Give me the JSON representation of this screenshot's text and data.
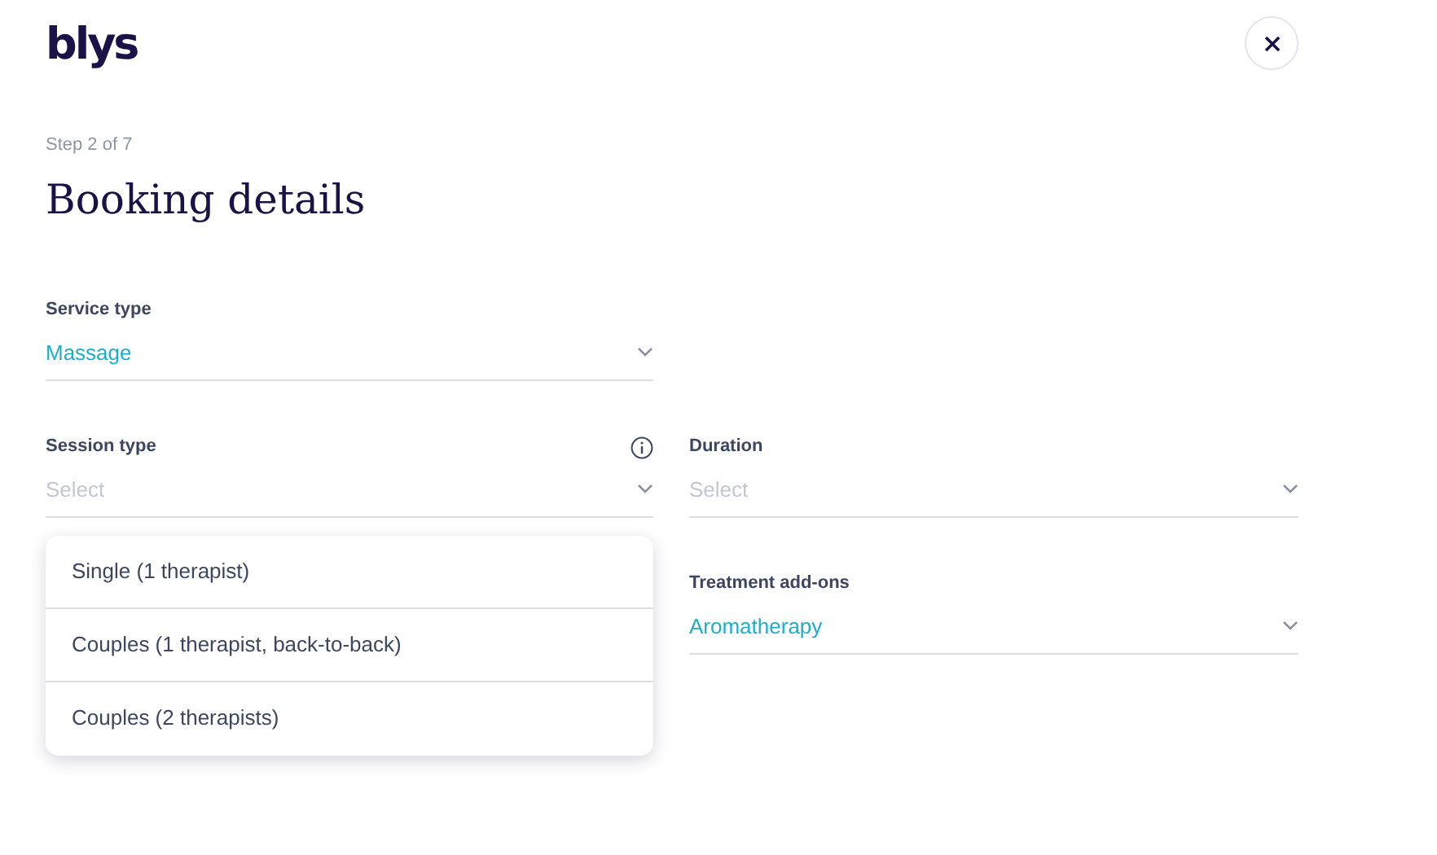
{
  "logo": "blys",
  "step": "Step 2 of 7",
  "title": "Booking details",
  "rows": [
    {
      "left": {
        "label": "Service type",
        "value": "Massage"
      }
    },
    {
      "left": {
        "label": "Session type",
        "placeholder": "Select",
        "info": true,
        "expanded": true,
        "options": [
          "Single (1 therapist)",
          "Couples (1 therapist, back-to-back)",
          "Couples (2 therapists)"
        ]
      },
      "right": {
        "label": "Duration",
        "placeholder": "Select"
      }
    },
    {
      "right": {
        "label": "Treatment add-ons",
        "value": "Aromatherapy"
      }
    }
  ]
}
